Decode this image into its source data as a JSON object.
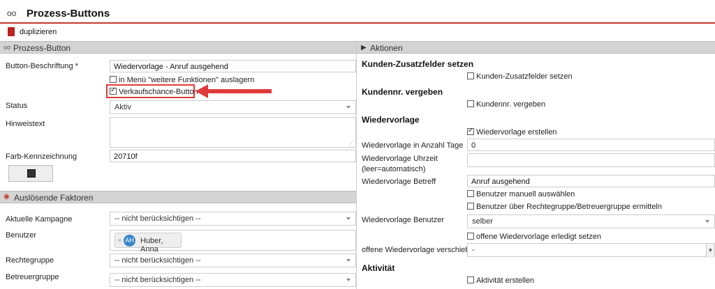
{
  "window": {
    "title": "Prozess-Buttons",
    "title_icon": "voicemail-icon"
  },
  "toolbar": {
    "duplicate_label": "duplizieren",
    "duplicate_icon": "duplicate-icon"
  },
  "left": {
    "section_title": "Prozess-Button",
    "button_label": {
      "label": "Button-Beschriftung *",
      "value": "Wiedervorlage - Anruf ausgehend"
    },
    "menu_checkbox": {
      "label": "in Menü \"weitere Funktionen\" auslagern",
      "checked": false
    },
    "sales_checkbox": {
      "label": "Verkaufschance-Button",
      "checked": true
    },
    "status": {
      "label": "Status",
      "value": "Aktiv"
    },
    "hint": {
      "label": "Hinweistext",
      "value": ""
    },
    "color": {
      "label": "Farb-Kennzeichnung",
      "value": "20710f"
    },
    "triggers_title": "Auslösende Faktoren",
    "campaign": {
      "label": "Aktuelle Kampagne",
      "value": "-- nicht berücksichtigen --"
    },
    "user": {
      "label": "Benutzer",
      "tag_initials": "AH",
      "tag_name": "Huber, Anna",
      "tag_remove": "×"
    },
    "rights_group": {
      "label": "Rechtegruppe",
      "value": "-- nicht berücksichtigen --"
    },
    "support_group": {
      "label": "Betreuergruppe",
      "value": "-- nicht berücksichtigen --"
    }
  },
  "right": {
    "section_title": "Aktionen",
    "customer_fields": {
      "heading": "Kunden-Zusatzfelder setzen",
      "checkbox_label": "Kunden-Zusatzfelder setzen",
      "checked": false
    },
    "customer_no": {
      "heading": "Kundennr. vergeben",
      "checkbox_label": "Kundennr. vergeben",
      "checked": false
    },
    "followup": {
      "heading": "Wiedervorlage",
      "create_label": "Wiedervorlage erstellen",
      "create_checked": true,
      "days_label": "Wiedervorlage in Anzahl Tage",
      "days_value": "0",
      "time_label_1": "Wiedervorlage Uhrzeit",
      "time_label_2": "(leer=automatisch)",
      "time_value": "",
      "subject_label": "Wiedervorlage Betreff",
      "subject_value": "Anruf ausgehend",
      "manual_user_label": "Benutzer manuell auswählen",
      "manual_user_checked": false,
      "group_user_label": "Benutzer über Rechtegruppe/Betreuergruppe ermitteln",
      "group_user_checked": false,
      "user_label": "Wiedervorlage Benutzer",
      "user_value": "selber",
      "open_done_label": "offene Wiedervorlage erledigt setzen",
      "open_done_checked": false,
      "move_label": "offene Wiedervorlage verschieben",
      "move_value": "-"
    },
    "activity": {
      "heading": "Aktivität",
      "checkbox_label": "Aktivität erstellen",
      "checked": false
    }
  },
  "colors": {
    "accent_red": "#c0392b",
    "highlight_red": "#e03b3b",
    "swatch": "#20710f"
  }
}
